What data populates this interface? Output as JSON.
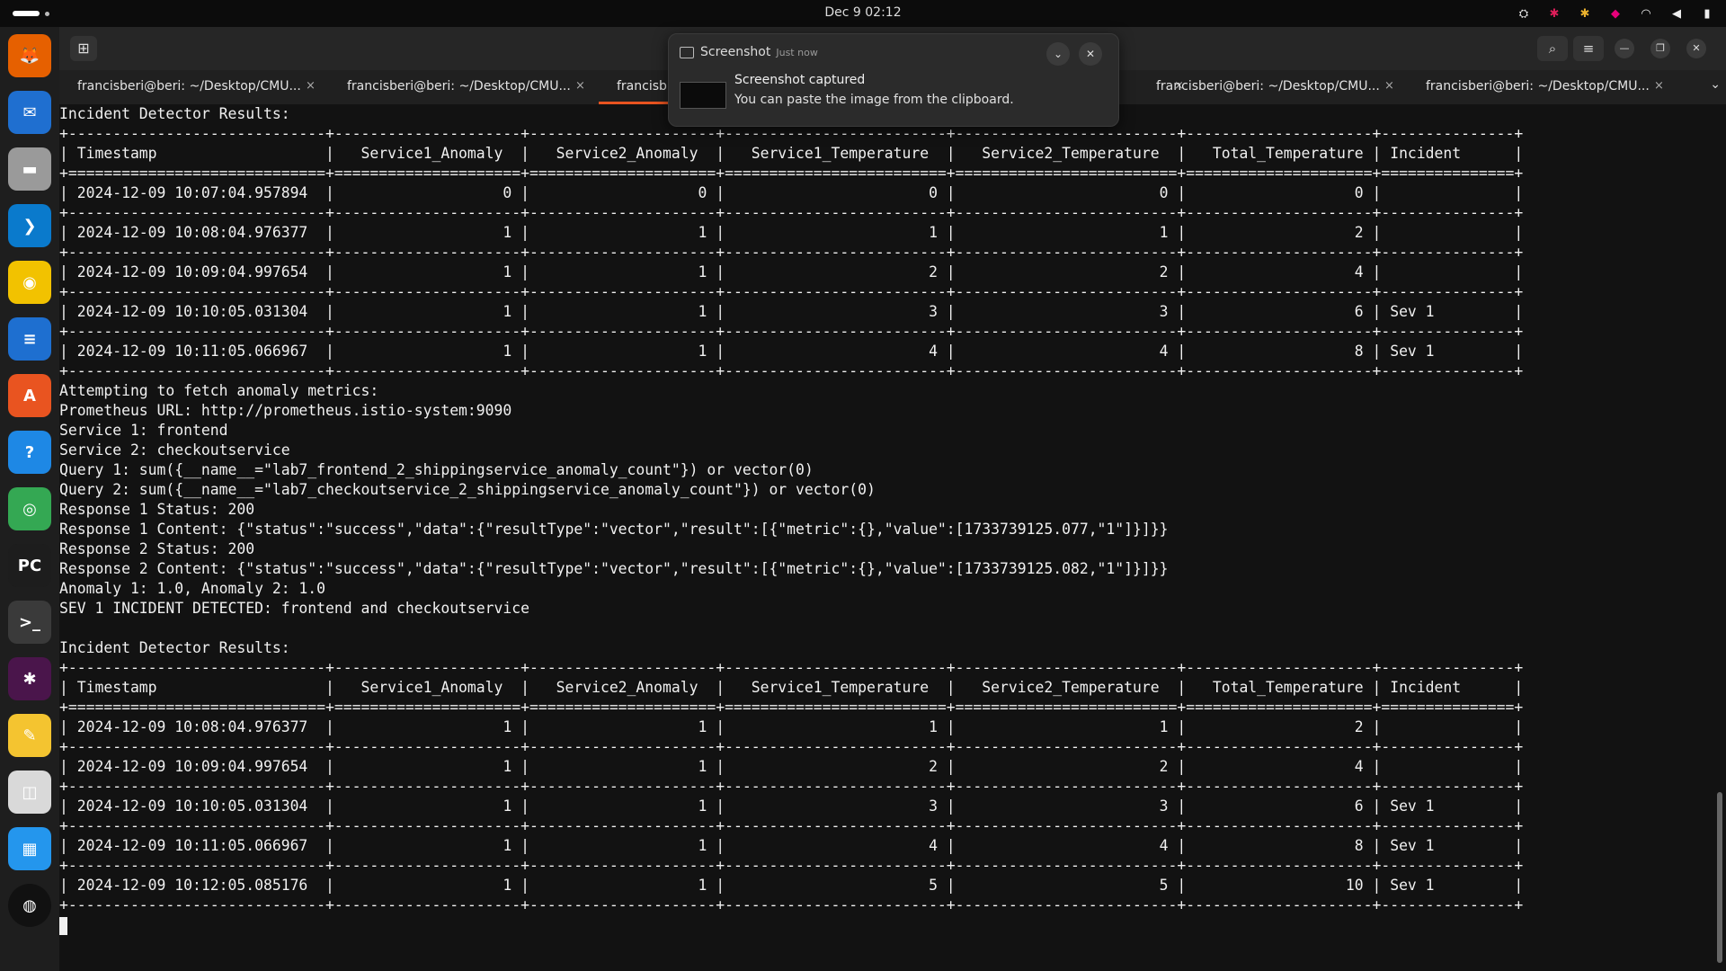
{
  "topbar": {
    "clock": "Dec 9  02:12",
    "tray_icons": [
      "steam-icon",
      "slack-icon",
      "slack-icon",
      "shield-icon",
      "wifi-icon",
      "volume-icon",
      "battery-icon"
    ]
  },
  "dock": {
    "apps": [
      {
        "name": "firefox-icon",
        "glyph": "🦊",
        "color": "#e66000"
      },
      {
        "name": "thunderbird-icon",
        "glyph": "✉",
        "color": "#1f6fd0"
      },
      {
        "name": "files-icon",
        "glyph": "▬",
        "color": "#9a9a9a"
      },
      {
        "name": "vscode-icon",
        "glyph": "❯",
        "color": "#0a7acc"
      },
      {
        "name": "rhythmbox-icon",
        "glyph": "◉",
        "color": "#f2c200"
      },
      {
        "name": "writer-icon",
        "glyph": "≡",
        "color": "#1e6fd0"
      },
      {
        "name": "app-center-icon",
        "glyph": "A",
        "color": "#e95420"
      },
      {
        "name": "help-icon",
        "glyph": "?",
        "color": "#1e88e5"
      },
      {
        "name": "chrome-icon",
        "glyph": "◎",
        "color": "#34a853"
      },
      {
        "name": "pycharm-icon",
        "glyph": "PC",
        "color": "#1d1d1d"
      },
      {
        "name": "terminal-icon",
        "glyph": ">_",
        "color": "#2d2d2d"
      },
      {
        "name": "slack-icon",
        "glyph": "✱",
        "color": "#4a154b"
      },
      {
        "name": "text-editor-icon",
        "glyph": "✎",
        "color": "#f4c430"
      },
      {
        "name": "document-viewer-icon",
        "glyph": "◫",
        "color": "#d9d9d9"
      },
      {
        "name": "docker-icon",
        "glyph": "▦",
        "color": "#2496ed"
      },
      {
        "name": "ubuntu-icon",
        "glyph": "◍",
        "color": "#111111"
      }
    ]
  },
  "tabs": [
    {
      "label": "francisberi@beri: ~/Desktop/CMU...",
      "active": false
    },
    {
      "label": "francisberi@beri: ~/Desktop/CMU...",
      "active": false
    },
    {
      "label": "francisb",
      "active": true
    },
    {
      "label": "",
      "active": false
    },
    {
      "label": "francisberi@beri: ~/Desktop/CMU...",
      "active": false
    },
    {
      "label": "francisberi@beri: ~/Desktop/CMU...",
      "active": false
    }
  ],
  "tab_close": "×",
  "notification": {
    "app": "Screenshot",
    "time": "Just now",
    "title": "Screenshot captured",
    "body": "You can paste the image from the clipboard."
  },
  "terminal": {
    "lines": [
      "Incident Detector Results:",
      "+-----------------------------+---------------------+---------------------+-------------------------+-------------------------+---------------------+---------------+",
      "| Timestamp                   |   Service1_Anomaly  |   Service2_Anomaly  |   Service1_Temperature  |   Service2_Temperature  |   Total_Temperature | Incident      |",
      "+=============================+=====================+=====================+=========================+=========================+=====================+===============+",
      "| 2024-12-09 10:07:04.957894  |                   0 |                   0 |                       0 |                       0 |                   0 |               |",
      "+-----------------------------+---------------------+---------------------+-------------------------+-------------------------+---------------------+---------------+",
      "| 2024-12-09 10:08:04.976377  |                   1 |                   1 |                       1 |                       1 |                   2 |               |",
      "+-----------------------------+---------------------+---------------------+-------------------------+-------------------------+---------------------+---------------+",
      "| 2024-12-09 10:09:04.997654  |                   1 |                   1 |                       2 |                       2 |                   4 |               |",
      "+-----------------------------+---------------------+---------------------+-------------------------+-------------------------+---------------------+---------------+",
      "| 2024-12-09 10:10:05.031304  |                   1 |                   1 |                       3 |                       3 |                   6 | Sev 1         |",
      "+-----------------------------+---------------------+---------------------+-------------------------+-------------------------+---------------------+---------------+",
      "| 2024-12-09 10:11:05.066967  |                   1 |                   1 |                       4 |                       4 |                   8 | Sev 1         |",
      "+-----------------------------+---------------------+---------------------+-------------------------+-------------------------+---------------------+---------------+",
      "Attempting to fetch anomaly metrics:",
      "Prometheus URL: http://prometheus.istio-system:9090",
      "Service 1: frontend",
      "Service 2: checkoutservice",
      "Query 1: sum({__name__=\"lab7_frontend_2_shippingservice_anomaly_count\"}) or vector(0)",
      "Query 2: sum({__name__=\"lab7_checkoutservice_2_shippingservice_anomaly_count\"}) or vector(0)",
      "Response 1 Status: 200",
      "Response 1 Content: {\"status\":\"success\",\"data\":{\"resultType\":\"vector\",\"result\":[{\"metric\":{},\"value\":[1733739125.077,\"1\"]}]}}",
      "Response 2 Status: 200",
      "Response 2 Content: {\"status\":\"success\",\"data\":{\"resultType\":\"vector\",\"result\":[{\"metric\":{},\"value\":[1733739125.082,\"1\"]}]}}",
      "Anomaly 1: 1.0, Anomaly 2: 1.0",
      "SEV 1 INCIDENT DETECTED: frontend and checkoutservice",
      "",
      "Incident Detector Results:",
      "+-----------------------------+---------------------+---------------------+-------------------------+-------------------------+---------------------+---------------+",
      "| Timestamp                   |   Service1_Anomaly  |   Service2_Anomaly  |   Service1_Temperature  |   Service2_Temperature  |   Total_Temperature | Incident      |",
      "+=============================+=====================+=====================+=========================+=========================+=====================+===============+",
      "| 2024-12-09 10:08:04.976377  |                   1 |                   1 |                       1 |                       1 |                   2 |               |",
      "+-----------------------------+---------------------+---------------------+-------------------------+-------------------------+---------------------+---------------+",
      "| 2024-12-09 10:09:04.997654  |                   1 |                   1 |                       2 |                       2 |                   4 |               |",
      "+-----------------------------+---------------------+---------------------+-------------------------+-------------------------+---------------------+---------------+",
      "| 2024-12-09 10:10:05.031304  |                   1 |                   1 |                       3 |                       3 |                   6 | Sev 1         |",
      "+-----------------------------+---------------------+---------------------+-------------------------+-------------------------+---------------------+---------------+",
      "| 2024-12-09 10:11:05.066967  |                   1 |                   1 |                       4 |                       4 |                   8 | Sev 1         |",
      "+-----------------------------+---------------------+---------------------+-------------------------+-------------------------+---------------------+---------------+",
      "| 2024-12-09 10:12:05.085176  |                   1 |                   1 |                       5 |                       5 |                  10 | Sev 1         |",
      "+-----------------------------+---------------------+---------------------+-------------------------+-------------------------+---------------------+---------------+"
    ]
  }
}
